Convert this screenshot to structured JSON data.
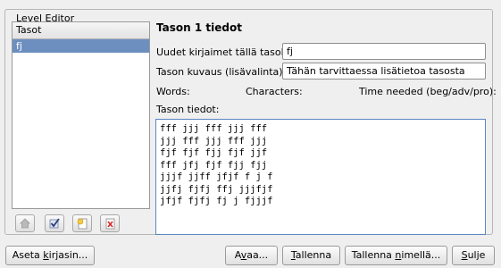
{
  "group": {
    "title": "Level Editor"
  },
  "levels_list": {
    "header": "Tasot",
    "items": [
      "fj"
    ]
  },
  "toolbar": {
    "icons": [
      "home-icon",
      "checkmark-icon",
      "add-document-icon",
      "delete-icon"
    ]
  },
  "details": {
    "title": "Tason 1 tiedot",
    "new_letters_label": "Uudet kirjaimet tällä tasolla",
    "new_letters_value": "fj",
    "description_label": "Tason kuvaus (lisävalinta):",
    "description_value": "Tähän tarvittaessa lisätietoa tasosta",
    "words_label": "Words:",
    "characters_label": "Characters:",
    "time_needed_label": "Time needed (beg/adv/pro):",
    "level_data_label": "Tason tiedot:",
    "level_text_lines": [
      "fff jjj fff jjj fff",
      "jjj fff jjj fff jjj",
      "fjf fjf fjj fjf jjf",
      "fff jfj fjf fjj fjj",
      "jjjf jjff jfjf f j f",
      "jjfj fjfj ffj jjjfjf",
      "jfjf fjfj fj j fjjjf"
    ]
  },
  "buttons": {
    "set_letters": {
      "pre": "Aseta ",
      "u": "k",
      "post": "irjasin..."
    },
    "open": {
      "pre": "A",
      "u": "v",
      "post": "aa..."
    },
    "save": {
      "pre": "",
      "u": "T",
      "post": "allenna"
    },
    "save_as": {
      "pre": "Tallenna ",
      "u": "n",
      "post": "imellä..."
    },
    "close": {
      "pre": "",
      "u": "S",
      "post": "ulje"
    }
  }
}
